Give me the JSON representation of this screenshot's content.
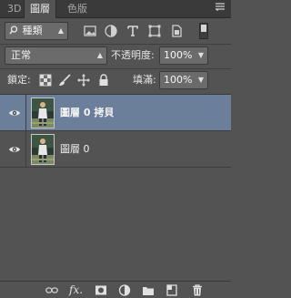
{
  "tabs": [
    {
      "label": "3D"
    },
    {
      "label": "圖層",
      "active": true
    },
    {
      "label": "色版"
    }
  ],
  "panel_menu_icon": "panel-menu-icon",
  "filter": {
    "search_icon": "search-icon",
    "kind_label": "種類",
    "filter_icons": [
      "image-filter-icon",
      "adjustment-filter-icon",
      "type-filter-icon",
      "shape-filter-icon",
      "smart-object-filter-icon"
    ]
  },
  "blend_mode": {
    "value": "正常"
  },
  "opacity": {
    "label": "不透明度:",
    "value": "100%"
  },
  "locks": {
    "label": "鎖定:",
    "icons": [
      "lock-transparent-icon",
      "lock-paint-icon",
      "lock-position-icon",
      "lock-all-icon"
    ]
  },
  "fill": {
    "label": "填滿:",
    "value": "100%"
  },
  "layers": [
    {
      "name": "圖層 0 拷貝",
      "selected": true,
      "visible": true
    },
    {
      "name": "圖層 0",
      "selected": false,
      "visible": true
    }
  ],
  "bottom_icons": [
    "link-layers-icon",
    "fx-icon",
    "add-mask-icon",
    "adjustment-layer-icon",
    "new-group-icon",
    "new-layer-icon",
    "delete-layer-icon"
  ],
  "fx_label": "fx.",
  "colors": {
    "panel": "#535353",
    "selected_layer": "#6c7f9a",
    "tabbar": "#3a3a3a"
  }
}
